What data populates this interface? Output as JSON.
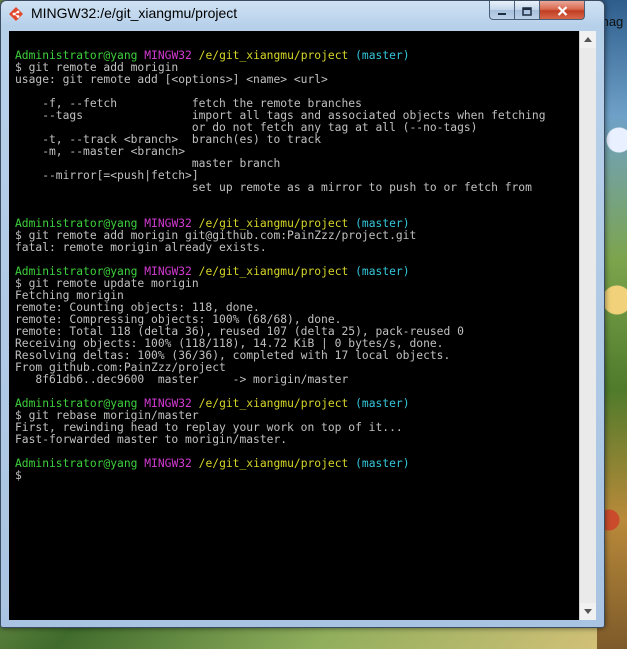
{
  "window": {
    "title": "MINGW32:/e/git_xiangmu/project"
  },
  "desktop": {
    "edge_text": "mag"
  },
  "icons": {
    "app": "git-bash-icon",
    "minimize": "minimize-icon",
    "maximize": "maximize-icon",
    "close": "close-icon"
  },
  "colors": {
    "user": "#3dd13d",
    "system": "#d23ad2",
    "path": "#d6d62a",
    "branch": "#35c6d9",
    "text": "#c0c0c0"
  },
  "terminal": {
    "lines": [
      {
        "type": "blank"
      },
      {
        "type": "prompt",
        "user": "Administrator@yang",
        "sys": "MINGW32",
        "path": "/e/git_xiangmu/project",
        "branch": "(master)"
      },
      {
        "type": "text",
        "text": "$ git remote add morigin"
      },
      {
        "type": "text",
        "text": "usage: git remote add [<options>] <name> <url>"
      },
      {
        "type": "blank"
      },
      {
        "type": "text",
        "text": "    -f, --fetch           fetch the remote branches"
      },
      {
        "type": "text",
        "text": "    --tags                import all tags and associated objects when fetching"
      },
      {
        "type": "text",
        "text": "                          or do not fetch any tag at all (--no-tags)"
      },
      {
        "type": "text",
        "text": "    -t, --track <branch>  branch(es) to track"
      },
      {
        "type": "text",
        "text": "    -m, --master <branch>"
      },
      {
        "type": "text",
        "text": "                          master branch"
      },
      {
        "type": "text",
        "text": "    --mirror[=<push|fetch>]"
      },
      {
        "type": "text",
        "text": "                          set up remote as a mirror to push to or fetch from"
      },
      {
        "type": "blank"
      },
      {
        "type": "blank"
      },
      {
        "type": "prompt",
        "user": "Administrator@yang",
        "sys": "MINGW32",
        "path": "/e/git_xiangmu/project",
        "branch": "(master)"
      },
      {
        "type": "text",
        "text": "$ git remote add morigin git@github.com:PainZzz/project.git"
      },
      {
        "type": "text",
        "text": "fatal: remote morigin already exists."
      },
      {
        "type": "blank"
      },
      {
        "type": "prompt",
        "user": "Administrator@yang",
        "sys": "MINGW32",
        "path": "/e/git_xiangmu/project",
        "branch": "(master)"
      },
      {
        "type": "text",
        "text": "$ git remote update morigin"
      },
      {
        "type": "text",
        "text": "Fetching morigin"
      },
      {
        "type": "text",
        "text": "remote: Counting objects: 118, done."
      },
      {
        "type": "text",
        "text": "remote: Compressing objects: 100% (68/68), done."
      },
      {
        "type": "text",
        "text": "remote: Total 118 (delta 36), reused 107 (delta 25), pack-reused 0"
      },
      {
        "type": "text",
        "text": "Receiving objects: 100% (118/118), 14.72 KiB | 0 bytes/s, done."
      },
      {
        "type": "text",
        "text": "Resolving deltas: 100% (36/36), completed with 17 local objects."
      },
      {
        "type": "text",
        "text": "From github.com:PainZzz/project"
      },
      {
        "type": "text",
        "text": "   8f61db6..dec9600  master     -> morigin/master"
      },
      {
        "type": "blank"
      },
      {
        "type": "prompt",
        "user": "Administrator@yang",
        "sys": "MINGW32",
        "path": "/e/git_xiangmu/project",
        "branch": "(master)"
      },
      {
        "type": "text",
        "text": "$ git rebase morigin/master"
      },
      {
        "type": "text",
        "text": "First, rewinding head to replay your work on top of it..."
      },
      {
        "type": "text",
        "text": "Fast-forwarded master to morigin/master."
      },
      {
        "type": "blank"
      },
      {
        "type": "prompt",
        "user": "Administrator@yang",
        "sys": "MINGW32",
        "path": "/e/git_xiangmu/project",
        "branch": "(master)"
      },
      {
        "type": "text",
        "text": "$"
      }
    ]
  }
}
